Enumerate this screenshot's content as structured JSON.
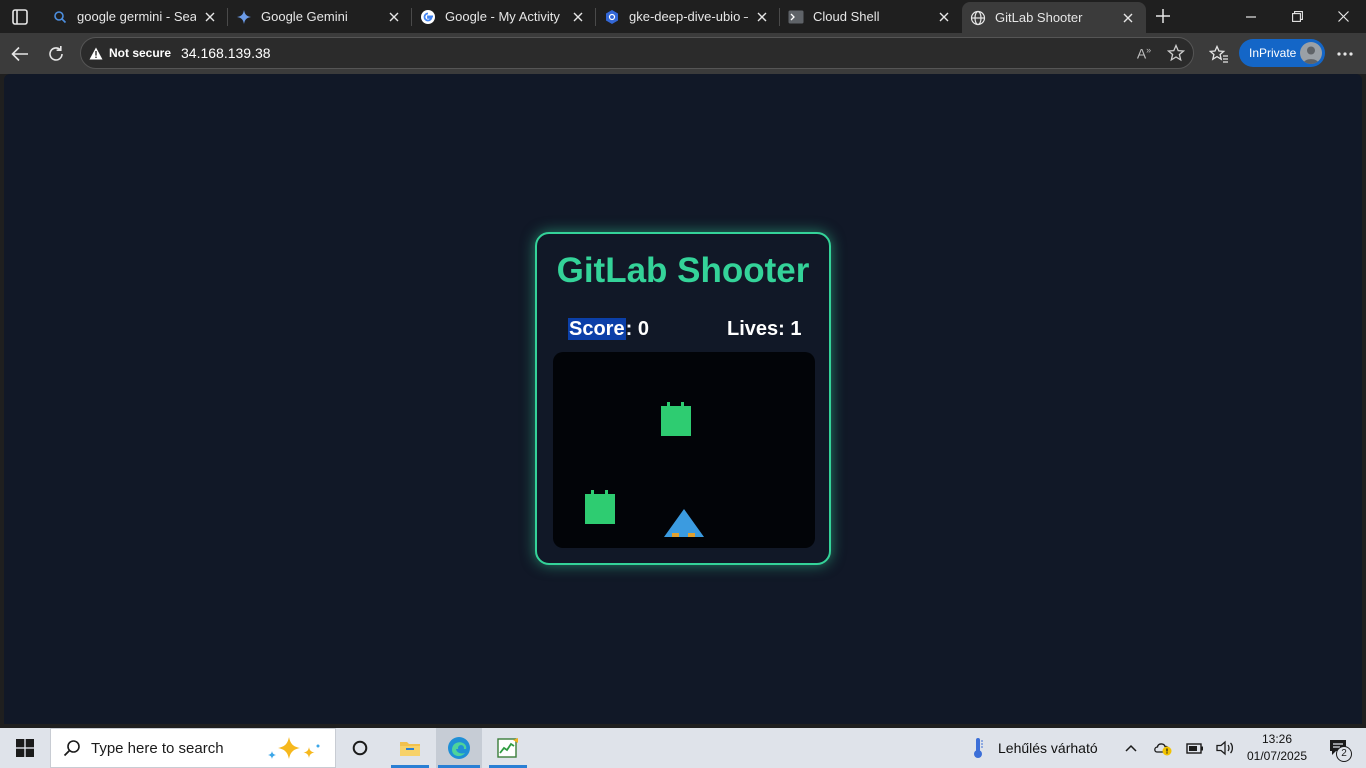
{
  "browser": {
    "tabs": [
      {
        "title": "google germini - Search",
        "favicon": "search-icon",
        "active": false
      },
      {
        "title": "Google Gemini",
        "favicon": "gemini-sparkle-icon",
        "active": false
      },
      {
        "title": "Google - My Activity",
        "favicon": "google-g-icon",
        "active": false
      },
      {
        "title": "gke-deep-dive-ubio – Kubernetes Engine",
        "favicon": "kubernetes-hexagon-icon",
        "active": false
      },
      {
        "title": "Cloud Shell",
        "favicon": "terminal-icon",
        "active": false
      },
      {
        "title": "GitLab Shooter",
        "favicon": "globe-icon",
        "active": true
      }
    ],
    "security_label": "Not secure",
    "url": "34.168.139.38",
    "inprivate_label": "InPrivate"
  },
  "game": {
    "title": "GitLab Shooter",
    "score_label": "Score",
    "score_value": "0",
    "lives_label": "Lives",
    "lives_value": "1",
    "enemy_color": "#2ecc71",
    "player_color": "#3b9be0",
    "accent_color": "#34d399"
  },
  "taskbar": {
    "search_placeholder": "Type here to search",
    "weather_text": "Lehűlés várható",
    "time": "13:26",
    "date": "01/07/2025",
    "notification_count": "2"
  }
}
